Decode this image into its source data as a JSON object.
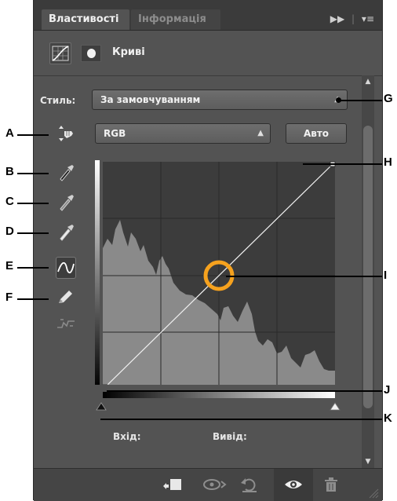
{
  "tabs": {
    "properties": "Властивості",
    "info": "Інформація"
  },
  "panel_menu_icons": [
    "double-chevron-icon",
    "panel-menu-icon"
  ],
  "header": {
    "title": "Криві"
  },
  "styles": {
    "label": "Стиль:",
    "value": "За замовчуванням"
  },
  "channel": {
    "value": "RGB"
  },
  "auto_button": "Авто",
  "tools": [
    "on-image-adjust-icon",
    "black-point-eyedropper-icon",
    "gray-point-eyedropper-icon",
    "white-point-eyedropper-icon",
    "curve-point-tool-icon",
    "pencil-draw-icon",
    "smooth-curve-icon"
  ],
  "graph": {
    "input_label": "Вхід:",
    "output_label": "Вивід:",
    "curve_points": [
      [
        0,
        0
      ],
      [
        255,
        255
      ]
    ]
  },
  "callouts": [
    "A",
    "B",
    "C",
    "D",
    "E",
    "F",
    "G",
    "H",
    "I",
    "J",
    "K"
  ],
  "bottom_icons": [
    "clip-to-layer-icon",
    "view-previous-state-icon",
    "reset-icon",
    "visibility-eye-icon",
    "delete-trash-icon"
  ]
}
